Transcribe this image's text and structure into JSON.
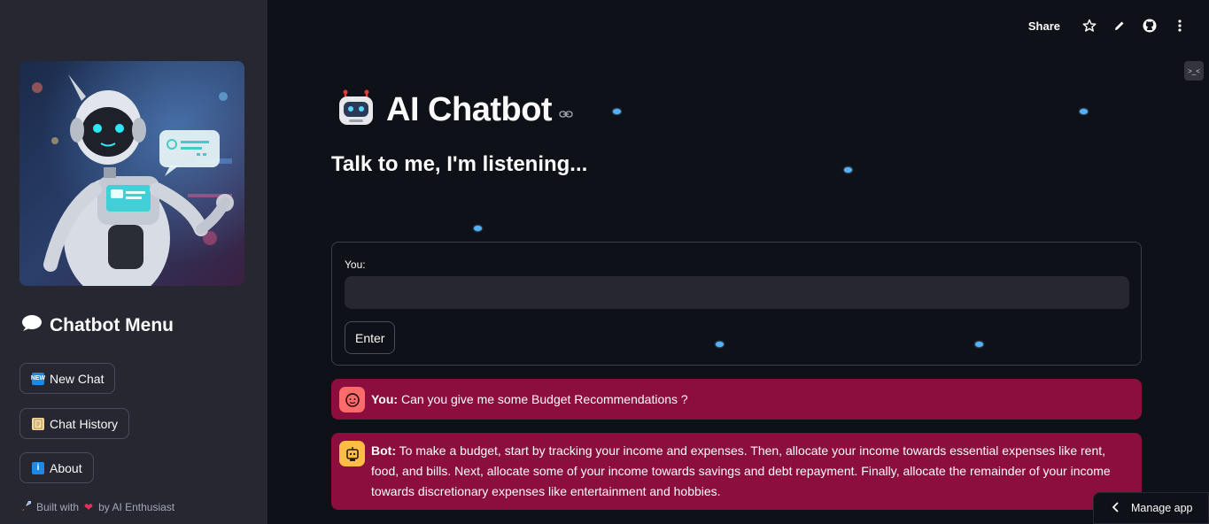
{
  "toolbar": {
    "share_label": "Share",
    "icons": [
      "star-icon",
      "pencil-icon",
      "github-icon",
      "more-vertical-icon"
    ]
  },
  "sidebar": {
    "menu_title": "Chatbot Menu",
    "buttons": [
      {
        "label": "New Chat",
        "icon": "new-badge-icon"
      },
      {
        "label": "Chat History",
        "icon": "scroll-icon"
      },
      {
        "label": "About",
        "icon": "info-icon"
      }
    ],
    "footer": {
      "built_with": "Built with",
      "by": "by AI Enthusiast"
    }
  },
  "main": {
    "title": "AI Chatbot",
    "subtitle": "Talk to me, I'm listening...",
    "form": {
      "label": "You:",
      "input_value": "",
      "enter_label": "Enter"
    },
    "messages": [
      {
        "speaker": "You:",
        "text": "Can you give me some Budget Recommendations ?"
      },
      {
        "speaker": "Bot:",
        "text": "To make a budget, start by tracking your income and expenses. Then, allocate your income towards essential expenses like rent, food, and bills. Next, allocate some of your income towards savings and debt repayment. Finally, allocate the remainder of your income towards discretionary expenses like entertainment and hobbies."
      }
    ]
  },
  "manage_app": {
    "label": "Manage app"
  },
  "colors": {
    "background": "#0e1117",
    "sidebar": "#262730",
    "message_bg": "#8b0e3e",
    "user_avatar": "#ff6b6b",
    "bot_avatar": "#ffbd45"
  }
}
